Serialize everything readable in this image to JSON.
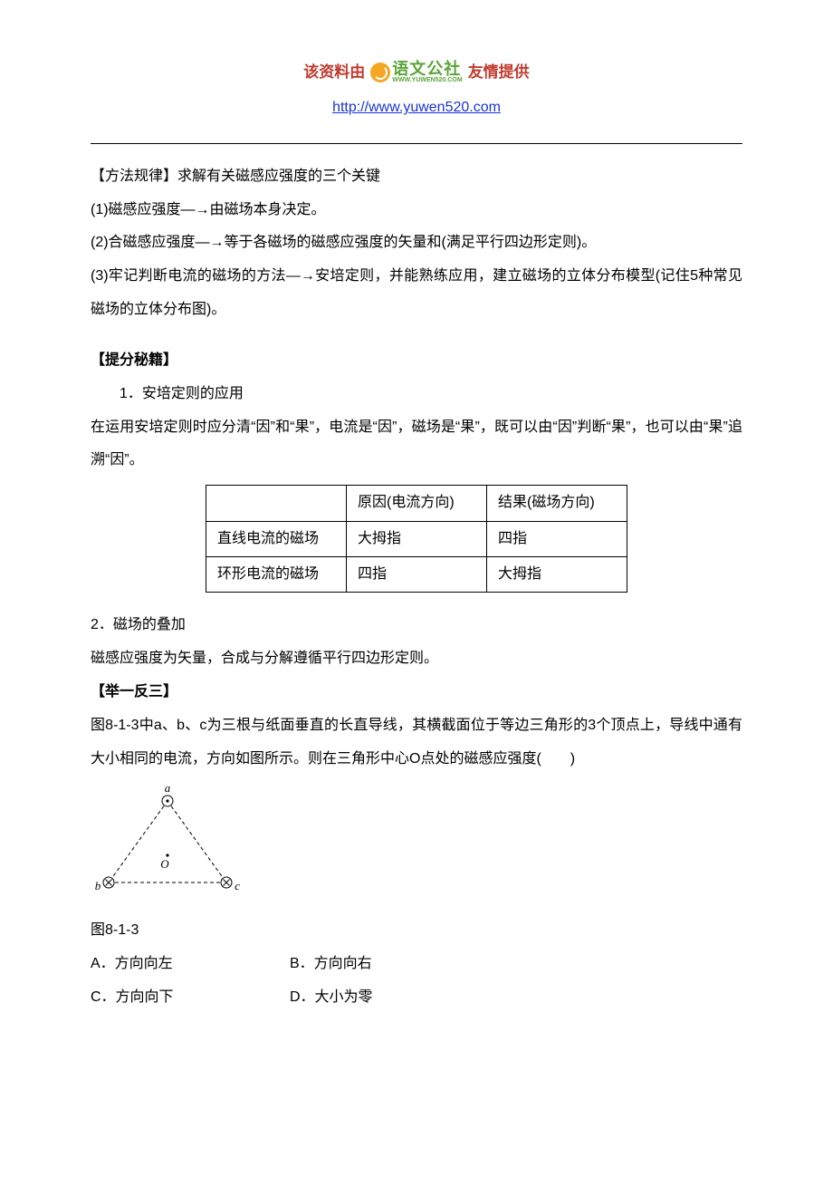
{
  "header": {
    "prefix": "该资料由",
    "logo_text": "语文公社",
    "logo_sub": "WWW.YUWEN520.COM",
    "suffix": "友情提供",
    "url": "http://www.yuwen520.com"
  },
  "body": {
    "p1": "【方法规律】求解有关磁感应强度的三个关键",
    "p2": "(1)磁感应强度―→由磁场本身决定。",
    "p3": "(2)合磁感应强度―→等于各磁场的磁感应强度的矢量和(满足平行四边形定则)。",
    "p4": "(3)牢记判断电流的磁场的方法―→安培定则，并能熟练应用，建立磁场的立体分布模型(记住5种常见磁场的立体分布图)。",
    "s1_title": "【提分秘籍】",
    "s1_item1": "1．安培定则的应用",
    "s1_text": "在运用安培定则时应分清“因”和“果”，电流是“因”，磁场是“果”，既可以由“因”判断“果”，也可以由“果”追溯“因”。",
    "table": {
      "h0": "",
      "h1": "原因(电流方向)",
      "h2": "结果(磁场方向)",
      "r1c0": "直线电流的磁场",
      "r1c1": "大拇指",
      "r1c2": "四指",
      "r2c0": "环形电流的磁场",
      "r2c1": "四指",
      "r2c2": "大拇指"
    },
    "s2_item": "2．磁场的叠加",
    "s2_text": "磁感应强度为矢量，合成与分解遵循平行四边形定则。",
    "ex_title": "【举一反三】",
    "ex_text": "图8-1-3中a、b、c为三根与纸面垂直的长直导线，其横截面位于等边三角形的3个顶点上，导线中通有大小相同的电流，方向如图所示。则在三角形中心O点处的磁感应强度(　　)",
    "fig_caption": "图8-1-3",
    "options": {
      "a": "A．方向向左",
      "b": "B．方向向右",
      "c": "C．方向向下",
      "d": "D．大小为零"
    },
    "labels": {
      "a": "a",
      "b": "b",
      "c": "c",
      "o": "O"
    }
  }
}
